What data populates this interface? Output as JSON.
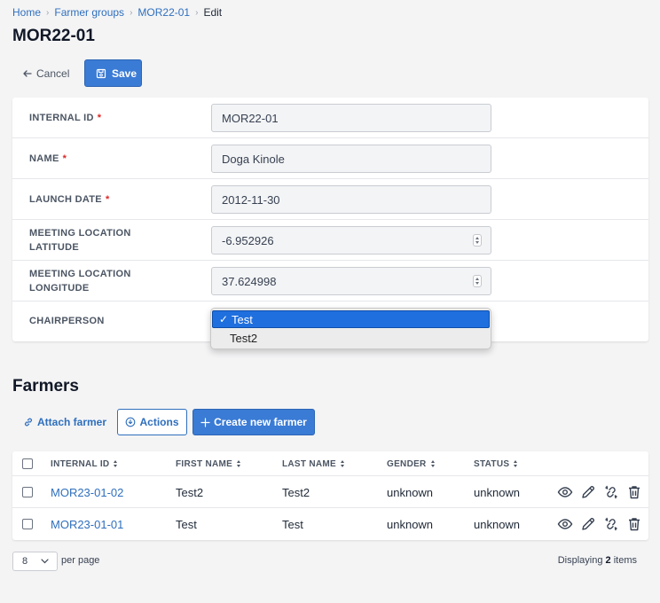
{
  "breadcrumb": {
    "items": [
      "Home",
      "Farmer groups",
      "MOR22-01"
    ],
    "current": "Edit"
  },
  "page_title": "MOR22-01",
  "toolbar": {
    "cancel_label": "Cancel",
    "save_label": "Save"
  },
  "form": {
    "fields": [
      {
        "label": "INTERNAL ID",
        "value": "MOR22-01",
        "required": true
      },
      {
        "label": "NAME",
        "value": "Doga Kinole",
        "required": true
      },
      {
        "label": "LAUNCH DATE",
        "value": "2012-11-30",
        "required": true
      },
      {
        "label": "MEETING LOCATION LATITUDE",
        "value": "-6.952926",
        "required": false
      },
      {
        "label": "MEETING LOCATION LONGITUDE",
        "value": "37.624998",
        "required": false
      },
      {
        "label": "CHAIRPERSON",
        "value": "Test",
        "required": false
      }
    ],
    "chairperson_options": [
      {
        "label": "Test",
        "selected": true
      },
      {
        "label": "Test2",
        "selected": false
      }
    ]
  },
  "farmers": {
    "title": "Farmers",
    "attach_label": "Attach farmer",
    "actions_label": "Actions",
    "create_label": "Create new farmer",
    "columns": [
      "INTERNAL ID",
      "FIRST NAME",
      "LAST NAME",
      "GENDER",
      "STATUS"
    ],
    "rows": [
      {
        "internal_id": "MOR23-01-02",
        "first_name": "Test2",
        "last_name": "Test2",
        "gender": "unknown",
        "status": "unknown"
      },
      {
        "internal_id": "MOR23-01-01",
        "first_name": "Test",
        "last_name": "Test",
        "gender": "unknown",
        "status": "unknown"
      }
    ]
  },
  "pagination": {
    "per_page_value": "8",
    "per_page_label": "per page",
    "displaying_prefix": "Displaying",
    "displaying_count": "2",
    "displaying_suffix": "items"
  },
  "colors": {
    "accent": "#3a7bd5",
    "link": "#2f6fbd",
    "required": "#dc2626"
  }
}
